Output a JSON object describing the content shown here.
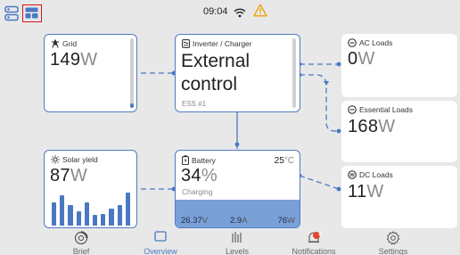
{
  "status_bar": {
    "time": "09:04"
  },
  "grid": {
    "title": "Grid",
    "value": "149",
    "unit": "W"
  },
  "inverter": {
    "title": "Inverter / Charger",
    "state_line1": "External",
    "state_line2": "control",
    "subtitle": "ESS #1"
  },
  "ac_loads": {
    "title": "AC Loads",
    "value": "0",
    "unit": "W"
  },
  "essential_loads": {
    "title": "Essential Loads",
    "value": "168",
    "unit": "W"
  },
  "solar": {
    "title": "Solar yield",
    "value": "87",
    "unit": "W",
    "bars": [
      0.62,
      0.82,
      0.55,
      0.38,
      0.62,
      0.28,
      0.32,
      0.45,
      0.55,
      0.88
    ]
  },
  "battery": {
    "title": "Battery",
    "temperature": "25",
    "temperature_unit": "°C",
    "soc": "34",
    "soc_unit": "%",
    "state": "Charging",
    "voltage": "26.37",
    "voltage_unit": "V",
    "current": "2.9",
    "current_unit": "A",
    "power": "76",
    "power_unit": "W"
  },
  "dc_loads": {
    "title": "DC Loads",
    "value": "11",
    "unit": "W"
  },
  "nav": {
    "brief": "Brief",
    "overview": "Overview",
    "levels": "Levels",
    "notifications": "Notifications",
    "notifications_badge": "2",
    "settings": "Settings"
  },
  "colors": {
    "accent": "#4a78c2",
    "warning": "#f0a000",
    "badge": "#e0452b",
    "highlight_box": "#d01818",
    "background": "#e8e8e8"
  }
}
